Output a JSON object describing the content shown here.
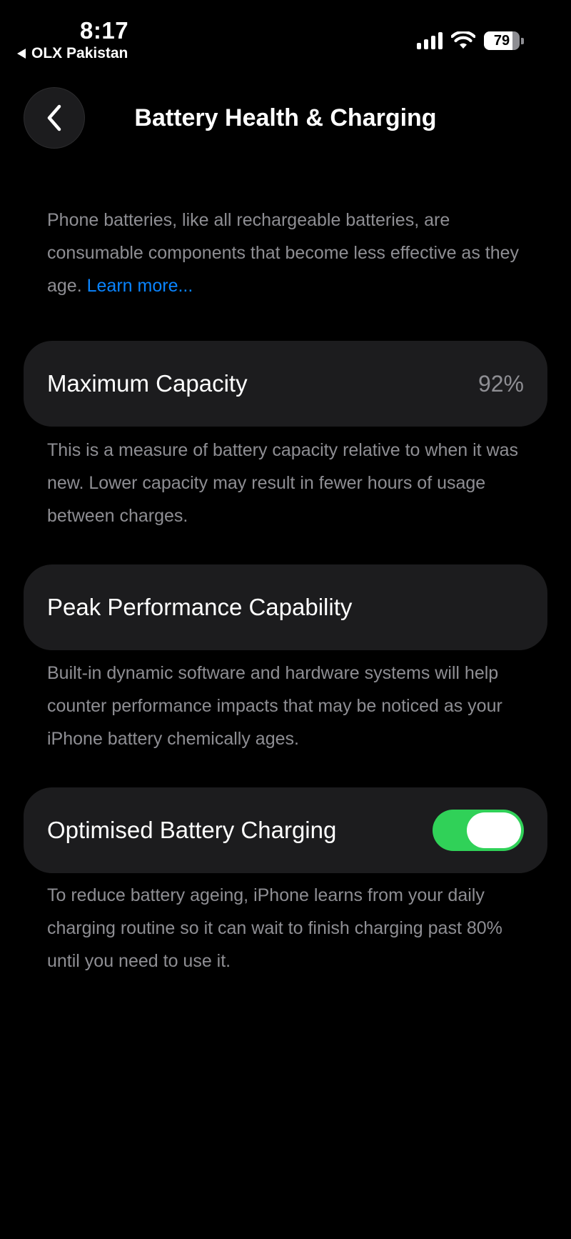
{
  "status_bar": {
    "time": "8:17",
    "back_app": "OLX Pakistan",
    "battery_level": "79",
    "battery_fraction": 0.79,
    "icons": [
      "cellular-signal-icon",
      "wifi-icon",
      "battery-icon"
    ]
  },
  "nav": {
    "title": "Battery Health & Charging",
    "back_icon": "chevron-left-icon"
  },
  "intro": {
    "text": "Phone batteries, like all rechargeable batteries, are consumable components that become less effective as they age.",
    "link": "Learn more..."
  },
  "max_capacity": {
    "label": "Maximum Capacity",
    "value": "92%",
    "description": "This is a measure of battery capacity relative to when it was new. Lower capacity may result in fewer hours of usage between charges."
  },
  "peak_performance": {
    "label": "Peak Performance Capability",
    "description": "Built-in dynamic software and hardware systems will help counter performance impacts that may be noticed as your iPhone battery chemically ages."
  },
  "optimised_charging": {
    "label": "Optimised Battery Charging",
    "enabled": true,
    "description": "To reduce battery ageing, iPhone learns from your daily charging routine so it can wait to finish charging past 80% until you need to use it."
  },
  "colors": {
    "background": "#000000",
    "card": "#1c1c1e",
    "secondary_text": "#8e8e93",
    "link": "#0a84ff",
    "toggle_on": "#30d158"
  }
}
